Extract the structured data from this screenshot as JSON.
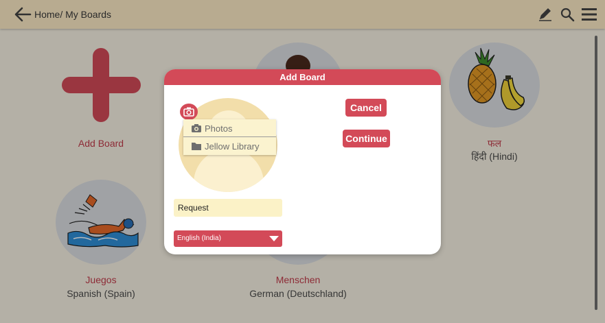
{
  "header": {
    "breadcrumb": "Home/ My Boards",
    "icons": [
      "back-arrow-icon",
      "pencil-icon",
      "search-icon",
      "hamburger-menu-icon"
    ]
  },
  "boards": [
    {
      "title": "Add Board",
      "subtitle": "",
      "icon": "plus-icon"
    },
    {
      "title": "",
      "subtitle": "",
      "icon": "person-icon"
    },
    {
      "title": "फल",
      "subtitle": "हिंदी (Hindi)",
      "icon": "fruit-icon"
    },
    {
      "title": "Juegos",
      "subtitle": "Spanish (Spain)",
      "icon": "swimming-icon"
    },
    {
      "title": "Menschen",
      "subtitle": "German (Deutschland)",
      "icon": "person-icon"
    }
  ],
  "dialog": {
    "title": "Add Board",
    "photo_menu": [
      {
        "label": "Photos",
        "icon": "camera-icon"
      },
      {
        "label": "Jellow Library",
        "icon": "folder-icon"
      }
    ],
    "name_value": "Request",
    "language": "English (India)",
    "cancel_label": "Cancel",
    "continue_label": "Continue"
  },
  "colors": {
    "accent": "#d34a58",
    "header_bg": "#fcebc6",
    "background": "#f7f2e4",
    "input_bg": "#fbf2c7",
    "avatar_bg": "#f2deaa"
  }
}
